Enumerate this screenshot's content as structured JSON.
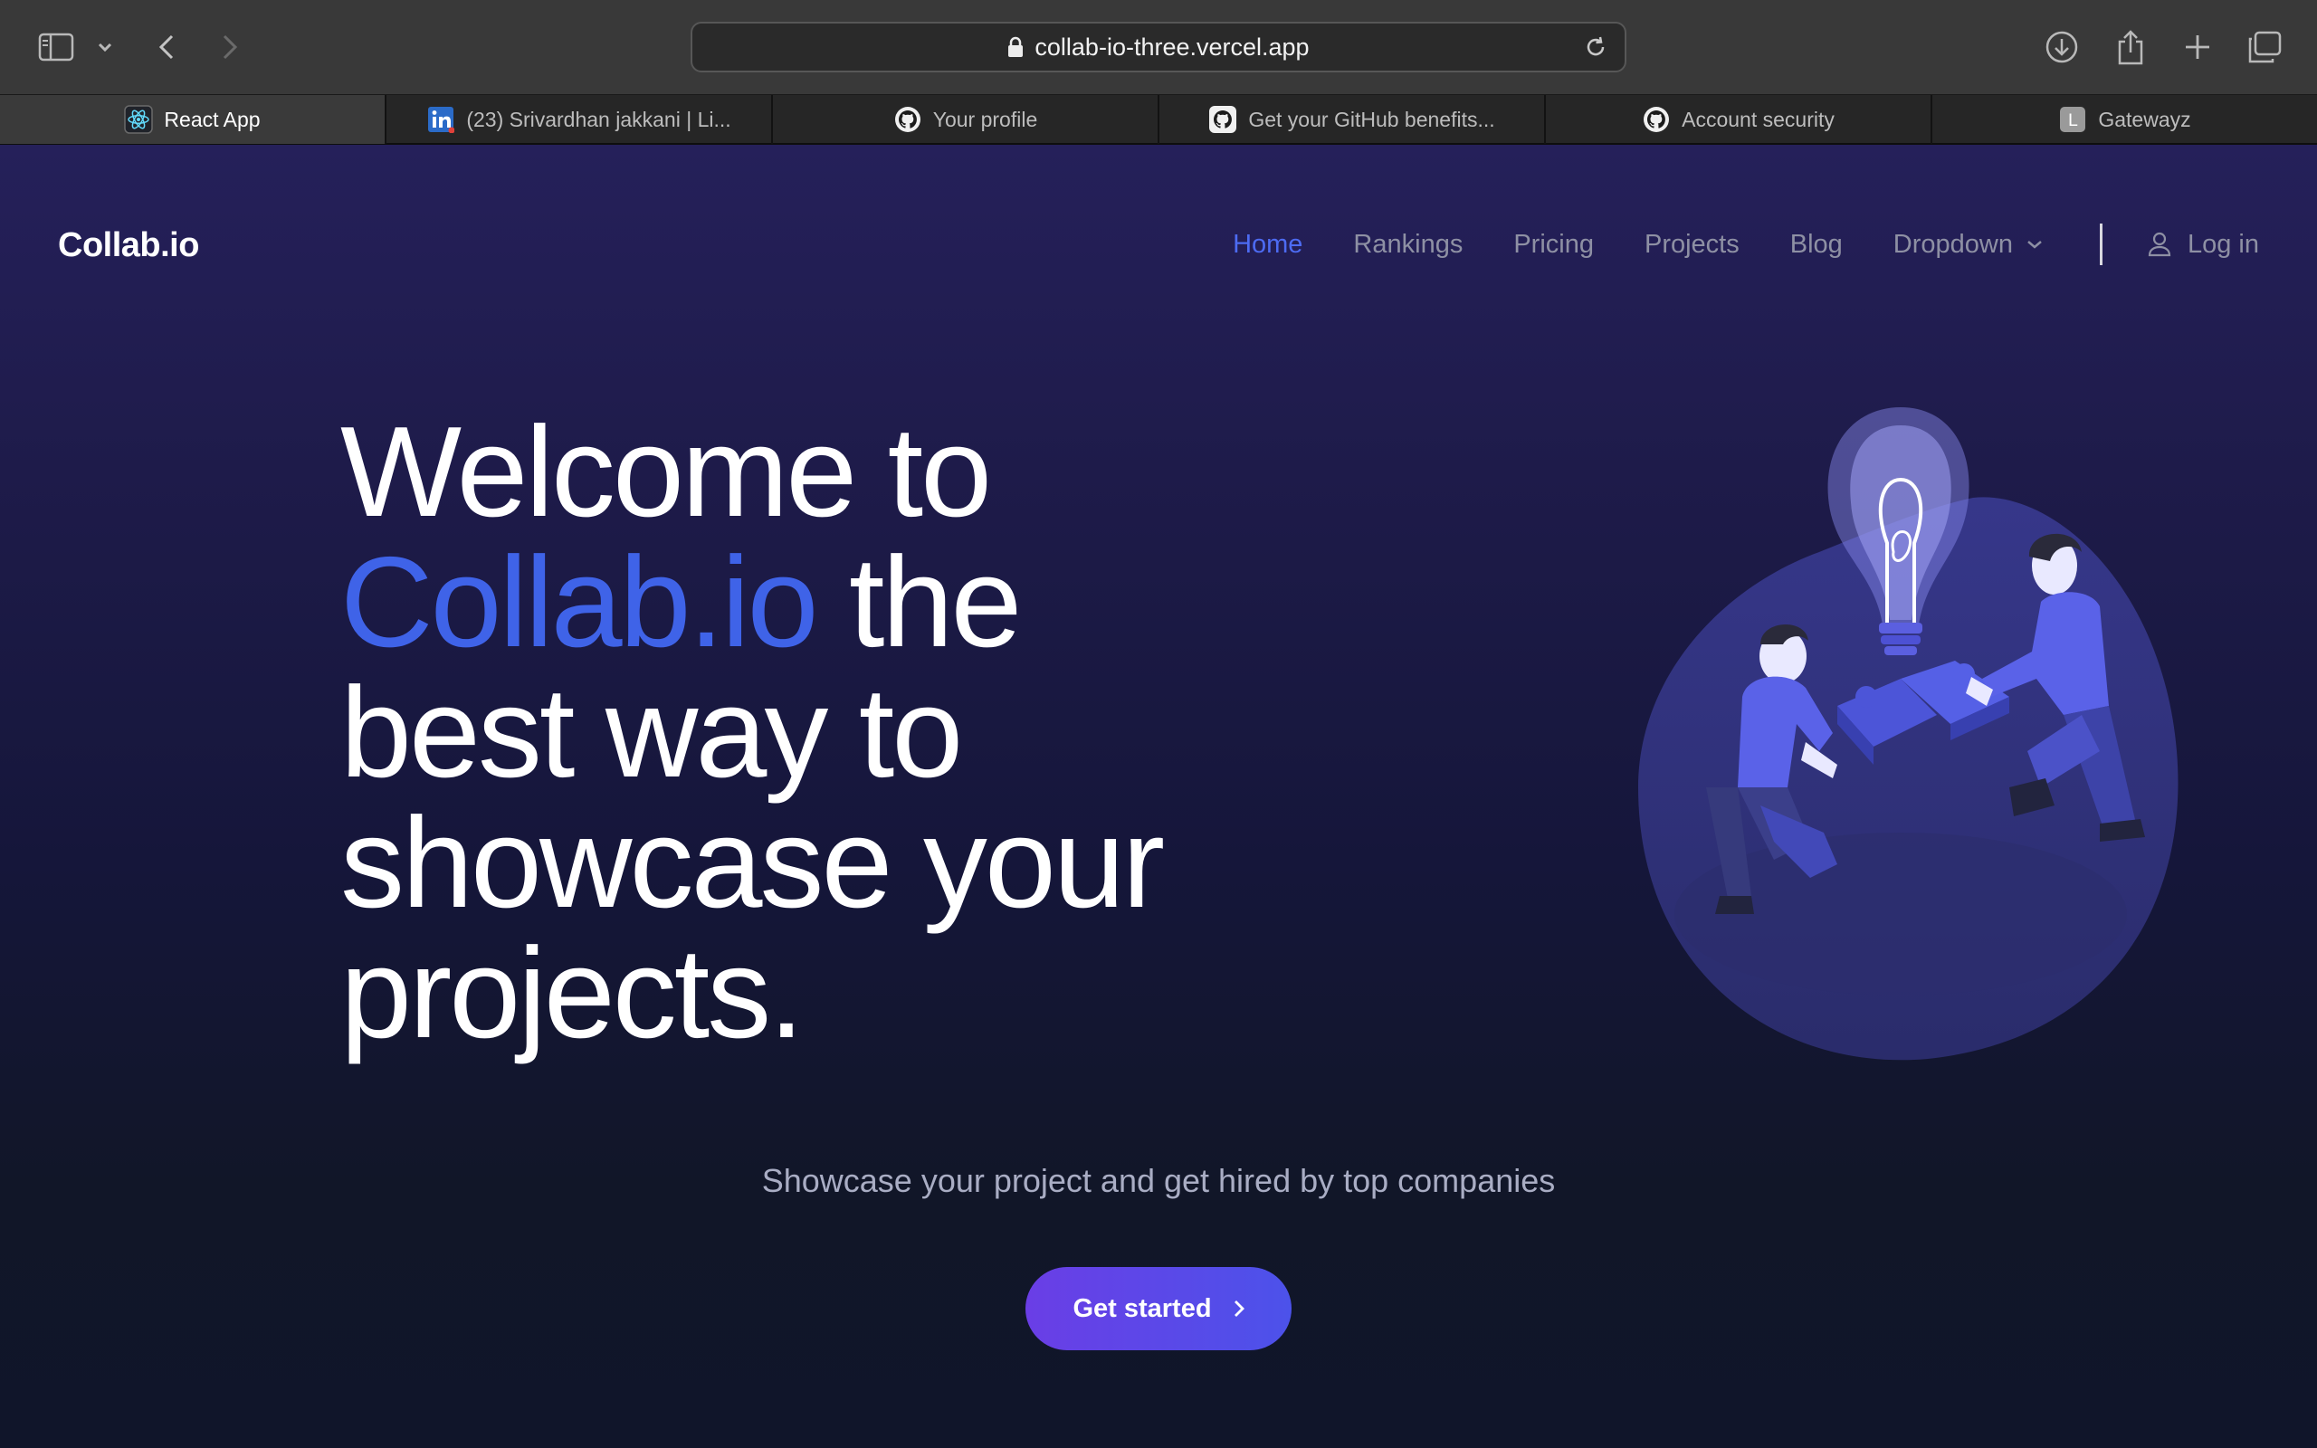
{
  "browser": {
    "url": "collab-io-three.vercel.app",
    "tabs": [
      {
        "label": "React App",
        "icon": "react-icon",
        "active": true
      },
      {
        "label": "(23) Srivardhan jakkani | Li...",
        "icon": "linkedin-icon",
        "active": false
      },
      {
        "label": "Your profile",
        "icon": "github-icon",
        "active": false
      },
      {
        "label": "Get your GitHub benefits...",
        "icon": "github-icon",
        "active": false
      },
      {
        "label": "Account security",
        "icon": "github-icon",
        "active": false
      },
      {
        "label": "Gatewayz",
        "icon": "letter-l-icon",
        "favicon_letter": "L",
        "active": false
      }
    ]
  },
  "nav": {
    "brand": "Collab.io",
    "items": [
      "Home",
      "Rankings",
      "Pricing",
      "Projects",
      "Blog",
      "Dropdown"
    ],
    "login": "Log in"
  },
  "hero": {
    "line1": "Welcome to",
    "accent": "Collab.io",
    "line2_rest": " the",
    "line3": "best way to",
    "line4": "showcase your",
    "line5": "projects.",
    "subtitle": "Showcase your project and get hired by top companies",
    "cta": "Get started"
  },
  "colors": {
    "accent": "#3f63e8",
    "cta_start": "#6a3ee6",
    "cta_end": "#4c52ea"
  }
}
